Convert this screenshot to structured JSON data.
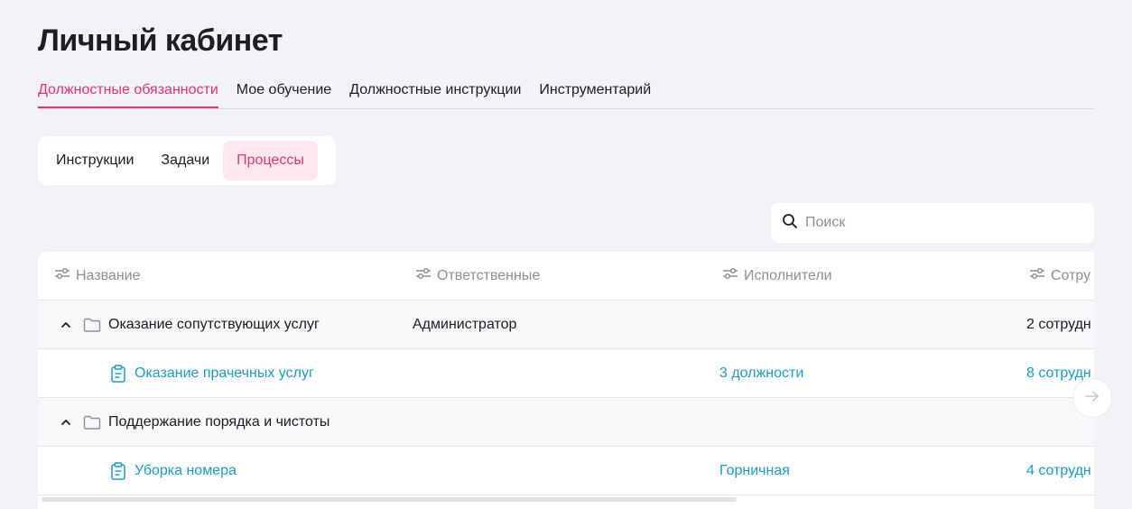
{
  "page": {
    "title": "Личный кабинет"
  },
  "main_tabs": [
    {
      "label": "Должностные обязанности",
      "active": true
    },
    {
      "label": "Мое обучение",
      "active": false
    },
    {
      "label": "Должностные инструкции",
      "active": false
    },
    {
      "label": "Инструментарий",
      "active": false
    }
  ],
  "segments": [
    {
      "label": "Инструкции",
      "active": false
    },
    {
      "label": "Задачи",
      "active": false
    },
    {
      "label": "Процессы",
      "active": true
    }
  ],
  "search": {
    "placeholder": "Поиск",
    "value": ""
  },
  "table": {
    "columns": [
      "Название",
      "Ответственные",
      "Исполнители",
      "Сотру"
    ],
    "rows": [
      {
        "type": "group",
        "expanded": true,
        "name": "Оказание сопутствующих услуг",
        "responsible": "Администратор",
        "executors": "",
        "employees": "2 сотрудн"
      },
      {
        "type": "item",
        "name": "Оказание прачечных услуг",
        "responsible": "",
        "executors": "3 должности",
        "employees": "8 сотрудн"
      },
      {
        "type": "group",
        "expanded": true,
        "name": "Поддержание порядка и чистоты",
        "responsible": "",
        "executors": "",
        "employees": ""
      },
      {
        "type": "item",
        "name": "Уборка номера",
        "responsible": "",
        "executors": "Горничная",
        "employees": "4 сотрудн"
      }
    ]
  },
  "colors": {
    "accent": "#e8336d",
    "link": "#1a9cc4",
    "muted": "#8d8f99"
  },
  "icons": [
    "search-icon",
    "filter-icon",
    "chevron-up-icon",
    "folder-icon",
    "clipboard-icon",
    "arrow-right-icon"
  ]
}
